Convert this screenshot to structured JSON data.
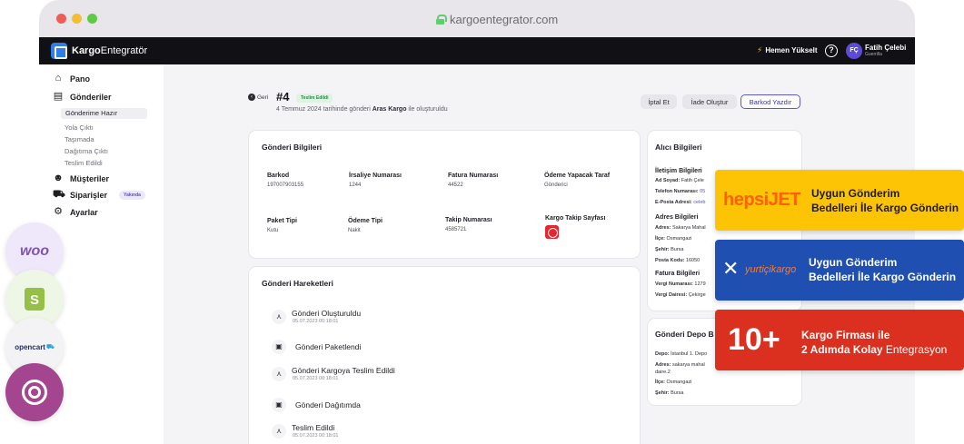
{
  "browser": {
    "url": "kargoentegrator.com",
    "traffic_lights": [
      "#ec5f57",
      "#f5bd2f",
      "#5fcb45"
    ]
  },
  "topbar": {
    "brand_bold": "Kargo",
    "brand_rest": "Entegratör",
    "upgrade_label": "Hemen Yükselt",
    "help_icon": "?",
    "avatar_initials": "FÇ",
    "user_name": "Fatih Çelebi",
    "user_company": "Guerrilla"
  },
  "sidebar": {
    "items": [
      {
        "label": "Pano",
        "icon": "home-icon"
      },
      {
        "label": "Gönderiler",
        "icon": "inbox-icon"
      },
      {
        "label": "Müşteriler",
        "icon": "users-icon"
      },
      {
        "label": "Siparişler",
        "icon": "cart-icon",
        "badge": "Yakında"
      },
      {
        "label": "Ayarlar",
        "icon": "gear-icon"
      }
    ],
    "sub_items": [
      "Gönderime Hazır",
      "Yola Çıktı",
      "Taşımada",
      "Dağıtıma Çıktı",
      "Teslim Edildi"
    ]
  },
  "header": {
    "back_label": "Geri",
    "order_no": "#4",
    "status": "Teslim Edildi",
    "subtitle_pre": "4 Temmuz 2024 tarihinde gönderi",
    "carrier": "Aras Kargo",
    "subtitle_post": "ile oluşturuldu",
    "buttons": {
      "cancel": "İptal Et",
      "return": "İade Oluştur",
      "barcode": "Barkod Yazdır"
    }
  },
  "shipment_info": {
    "title": "Gönderi Bilgileri",
    "fields": [
      {
        "label": "Barkod",
        "value": "197007903155"
      },
      {
        "label": "İrsaliye Numarası",
        "value": "1244"
      },
      {
        "label": "Fatura Numarası",
        "value": "44522"
      },
      {
        "label": "Ödeme Yapacak Taraf",
        "value": "Gönderici"
      },
      {
        "label": "Paket Tipi",
        "value": "Kutu"
      },
      {
        "label": "Ödeme Tipi",
        "value": "Nakit"
      },
      {
        "label": "Takip Numarası",
        "value": "4585721"
      },
      {
        "label": "Kargo Takip Sayfası",
        "value": ""
      }
    ]
  },
  "movements": {
    "title": "Gönderi Hareketleri",
    "events": [
      {
        "title": "Gönderi Oluşturuldu",
        "time": "05.07.2023 00:18:01"
      },
      {
        "title": "Gönderi Paketlendi",
        "time": ""
      },
      {
        "title": "Gönderi Kargoya Teslim Edildi",
        "time": "05.07.2023 00:18:01"
      },
      {
        "title": "Gönderi Dağıtımda",
        "time": ""
      },
      {
        "title": "Teslim Edildi",
        "time": "05.07.2023 00:18:01"
      }
    ]
  },
  "recipient": {
    "title": "Alıcı Bilgileri",
    "contact_title": "İletişim Bilgileri",
    "name_label": "Ad Soyad:",
    "name_value": "Fatih Çele",
    "phone_label": "Telefon Numarası:",
    "phone_value": "05",
    "email_label": "E-Posta Adresi:",
    "email_value": "celeb",
    "address_title": "Adres Bilgileri",
    "address_label": "Adres:",
    "address_value": "Sakarya Mahal",
    "district_label": "İlçe:",
    "district_value": "Osmangazi",
    "city_label": "Şehir:",
    "city_value": "Bursa",
    "postal_label": "Posta Kodu:",
    "postal_value": "16050",
    "invoice_title": "Fatura Bilgileri",
    "tax_no_label": "Vergi Numarası:",
    "tax_no_value": "1279",
    "tax_office_label": "Vergi Dairesi:",
    "tax_office_value": "Çekirge"
  },
  "depot": {
    "title": "Gönderi Depo B",
    "depot_label": "Depo:",
    "depot_value": "İstanbul 1. Depo",
    "address_label": "Adres:",
    "address_value": "sakarya mahal",
    "address_value2": "daire.2",
    "district_label": "İlçe:",
    "district_value": "Osmangazi",
    "city_label": "Şehir:",
    "city_value": "Bursa"
  },
  "plugins": {
    "woo": "woo",
    "shopify": "S",
    "opencart": "opencart"
  },
  "promos": {
    "hepsijet": {
      "logo_a": "hepsi",
      "logo_b": "JET",
      "line1": "Uygun Gönderim",
      "line2": "Bedelleri İle Kargo Gönderin"
    },
    "yurtici": {
      "logo_a": "yurtiçi",
      "logo_b": "kargo",
      "line1": "Uygun Gönderim",
      "line2": "Bedelleri İle Kargo Gönderin"
    },
    "count": {
      "big": "10+",
      "line1": "Kargo Firması ile",
      "line2_bold": "2 Adımda Kolay",
      "line2_rest": "Entegrasyon"
    }
  }
}
